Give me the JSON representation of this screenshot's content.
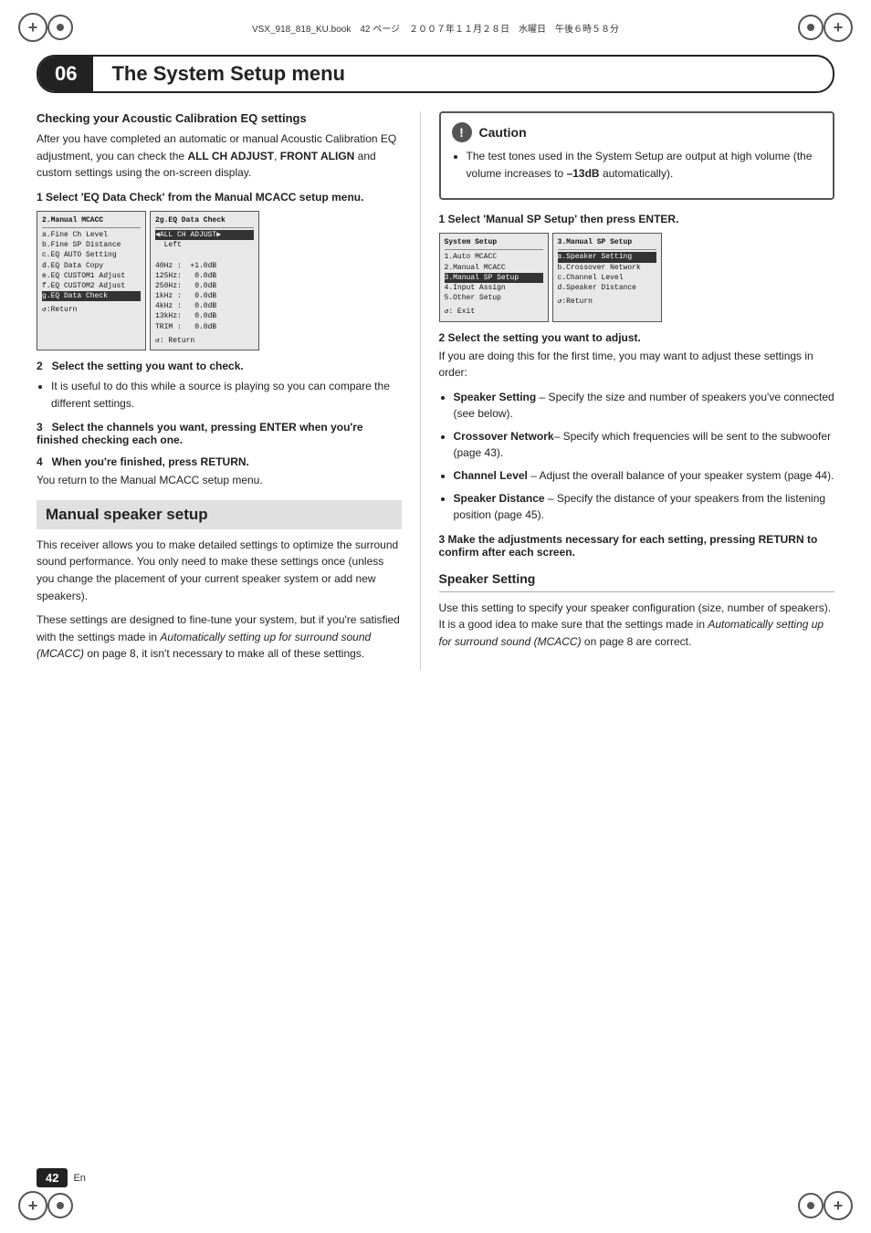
{
  "page": {
    "number": "42",
    "lang": "En"
  },
  "top_bar": {
    "text": "VSX_918_818_KU.book　42 ページ　２００７年１１月２８日　水曜日　午後６時５８分"
  },
  "chapter": {
    "number": "06",
    "title": "The System Setup menu"
  },
  "left_column": {
    "section1": {
      "heading": "Checking your Acoustic Calibration EQ settings",
      "body1": "After you have completed an automatic or manual Acoustic Calibration EQ adjustment, you can check the ALL CH ADJUST, FRONT ALIGN and custom settings using the on-screen display.",
      "step1": "1   Select 'EQ Data Check' from the Manual MCACC setup menu.",
      "screen1_title": "2.Manual MCACC",
      "screen1_items": [
        "a.Fine Ch Level",
        "b.Fine SP Distance",
        "c.EQ AUTO Setting",
        "d.EQ Data Copy",
        "e.EQ CUSTOM1 Adjust",
        "f.EQ CUSTOM2 Adjust",
        "g.EQ Data Check"
      ],
      "screen1_highlighted": "g.EQ Data Check",
      "screen1_footer": "↺:Return",
      "screen2_title": "2g.EQ Data Check",
      "screen2_items": [
        "◀ALL CH ADJUST▶",
        "  Left",
        "",
        "40Hz :  +1.0dB",
        "125Hz :   0.0dB",
        "250Hz :   0.0dB",
        "1kHz :   0.0dB",
        "4kHz :   0.0dB",
        "13kHz :   0.0dB",
        "TRIM :   0.0dB"
      ],
      "screen2_footer": "↺: Return",
      "step2": "2   Select the setting you want to check.",
      "step2_bullet": "It is useful to do this while a source is playing so you can compare the different settings.",
      "step3": "3   Select the channels you want, pressing ENTER when you're finished checking each one.",
      "step4": "4   When you're finished, press RETURN.",
      "step4_body": "You return to the Manual MCACC setup menu."
    },
    "section2": {
      "heading": "Manual speaker setup",
      "body1": "This receiver allows you to make detailed settings to optimize the surround sound performance. You only need to make these settings once (unless you change the placement of your current speaker system or add new speakers).",
      "body2": "These settings are designed to fine-tune your system, but if you're satisfied with the settings made in Automatically setting up for surround sound (MCACC) on page 8, it isn't necessary to make all of these settings."
    }
  },
  "right_column": {
    "caution": {
      "icon": "!",
      "title": "Caution",
      "bullet": "The test tones used in the System Setup are output at high volume (the volume increases to –13dB automatically)."
    },
    "step1": "1   Select 'Manual SP Setup' then press ENTER.",
    "screen_left_title": "System Setup",
    "screen_left_items": [
      "1.Auto MCACC",
      "2.Manual MCACC",
      "3.Manual SP Setup",
      "4.Input Assign",
      "5.Other Setup"
    ],
    "screen_left_highlighted": "3.Manual SP Setup",
    "screen_left_footer": "↺: Exit",
    "screen_right_title": "3.Manual SP Setup",
    "screen_right_items": [
      "a.Speaker Setting",
      "b.Crossover Network",
      "c.Channel Level",
      "d.Speaker Distance"
    ],
    "screen_right_highlighted": "a.Speaker Setting",
    "screen_right_footer": "↺:Return",
    "step2": "2   Select the setting you want to adjust.",
    "step2_body": "If you are doing this for the first time, you may want to adjust these settings in order:",
    "bullets": [
      {
        "label": "Speaker Setting",
        "text": "– Specify the size and number of speakers you've connected (see below)."
      },
      {
        "label": "Crossover Network",
        "text": "– Specify which frequencies will be sent to the subwoofer (page 43)."
      },
      {
        "label": "Channel Level",
        "text": "– Adjust the overall balance of your speaker system (page 44)."
      },
      {
        "label": "Speaker Distance",
        "text": "– Specify the distance of your speakers from the listening position (page 45)."
      }
    ],
    "step3": "3   Make the adjustments necessary for each setting, pressing RETURN to confirm after each screen.",
    "speaker_setting_heading": "Speaker Setting",
    "speaker_setting_body": "Use this setting to specify your speaker configuration (size, number of speakers). It is a good idea to make sure that the settings made in Automatically setting up for surround sound (MCACC) on page 8 are correct."
  }
}
